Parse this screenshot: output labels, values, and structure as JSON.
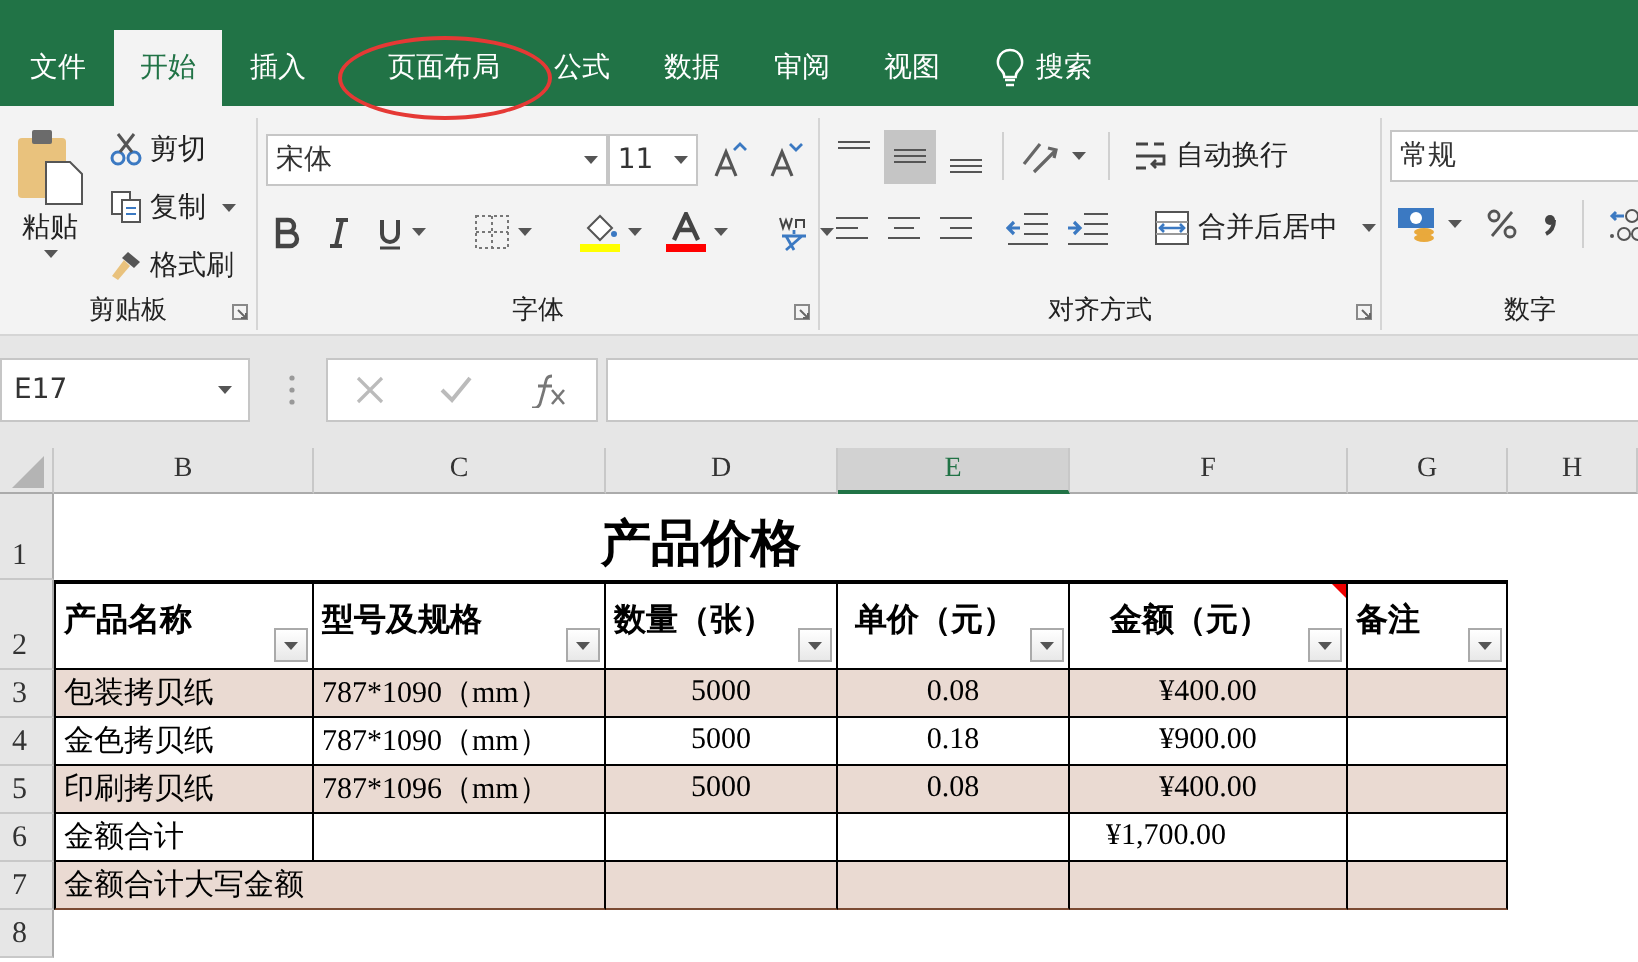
{
  "tabs": [
    {
      "label": "文件",
      "selected": false,
      "circled": false
    },
    {
      "label": "开始",
      "selected": true,
      "circled": false
    },
    {
      "label": "插入",
      "selected": false,
      "circled": false
    },
    {
      "label": "页面布局",
      "selected": false,
      "circled": true
    },
    {
      "label": "公式",
      "selected": false,
      "circled": false
    },
    {
      "label": "数据",
      "selected": false,
      "circled": false
    },
    {
      "label": "审阅",
      "selected": false,
      "circled": false
    },
    {
      "label": "视图",
      "selected": false,
      "circled": false
    }
  ],
  "search": {
    "label": "搜索"
  },
  "ribbon": {
    "clipboard": {
      "title": "剪贴板",
      "paste": "粘贴",
      "cut": "剪切",
      "copy": "复制",
      "format_painter": "格式刷"
    },
    "font": {
      "title": "字体",
      "font_name": "宋体",
      "font_size": "11"
    },
    "alignment": {
      "title": "对齐方式",
      "vertical": [
        {
          "selected": false
        },
        {
          "selected": true
        },
        {
          "selected": false
        }
      ],
      "wrap_text": "自动换行",
      "merge_center": "合并后居中"
    },
    "number": {
      "title": "数字",
      "format": "常规"
    }
  },
  "formula_bar": {
    "name_box": "E17"
  },
  "sheet": {
    "columns": [
      {
        "label": "B",
        "selected": false
      },
      {
        "label": "C",
        "selected": false
      },
      {
        "label": "D",
        "selected": false
      },
      {
        "label": "E",
        "selected": true
      },
      {
        "label": "F",
        "selected": false
      },
      {
        "label": "G",
        "selected": false
      },
      {
        "label": "H",
        "selected": false
      }
    ],
    "rows": [
      {
        "number": "1",
        "kind": "title",
        "text": "产品价格"
      },
      {
        "number": "2",
        "kind": "header",
        "cells": {
          "B": {
            "text": "产品名称",
            "comment": false
          },
          "C": {
            "text": "型号及规格",
            "comment": false
          },
          "D": {
            "text": "数量（张）",
            "comment": false
          },
          "E": {
            "text": "单价（元）",
            "comment": false
          },
          "F": {
            "text": "金额（元）",
            "comment": true
          },
          "G": {
            "text": "备注",
            "comment": false
          }
        }
      },
      {
        "number": "3",
        "kind": "data",
        "shaded": true,
        "cells": {
          "B": "包装拷贝纸",
          "C": "787*1090（mm）",
          "D": "5000",
          "E": "0.08",
          "F": "¥400.00"
        }
      },
      {
        "number": "4",
        "kind": "data",
        "shaded": false,
        "cells": {
          "B": "金色拷贝纸",
          "C": "787*1090（mm）",
          "D": "5000",
          "E": "0.18",
          "F": "¥900.00"
        }
      },
      {
        "number": "5",
        "kind": "data",
        "shaded": true,
        "cells": {
          "B": "印刷拷贝纸",
          "C": "787*1096（mm）",
          "D": "5000",
          "E": "0.08",
          "F": "¥400.00"
        }
      },
      {
        "number": "6",
        "kind": "data",
        "shaded": false,
        "cells": {
          "B": "金额合计",
          "F": "¥1,700.00"
        }
      },
      {
        "number": "7",
        "kind": "merged_label",
        "shaded": true,
        "cells": {
          "B": "金额合计大写金额"
        }
      },
      {
        "number": "8",
        "kind": "empty"
      }
    ]
  }
}
